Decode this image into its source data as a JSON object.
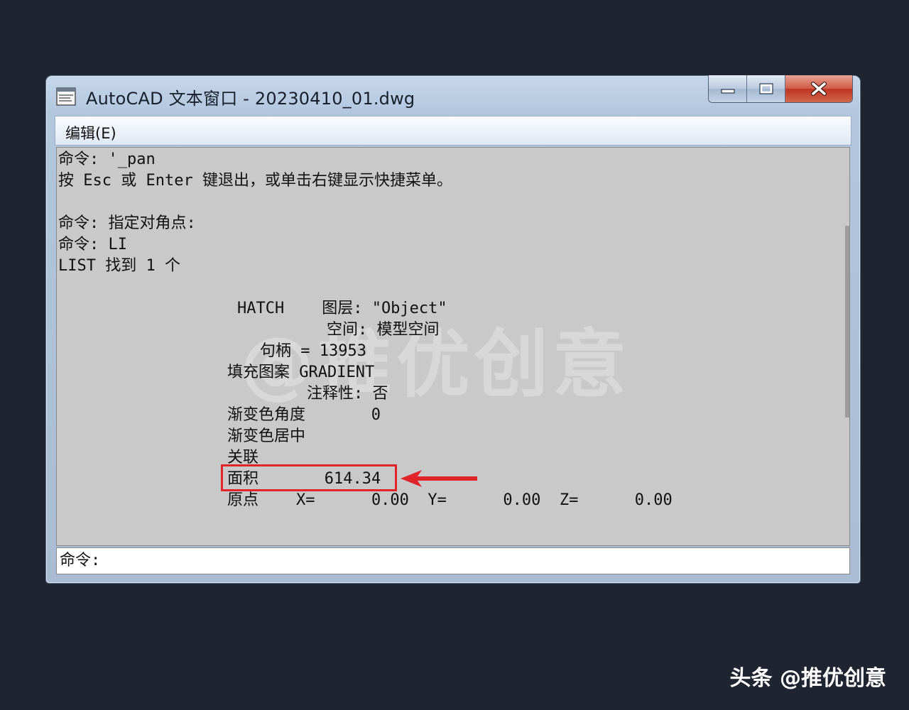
{
  "window": {
    "title": "AutoCAD 文本窗口 - 20230410_01.dwg",
    "controls": {
      "minimize_icon": "minimize-icon",
      "maximize_icon": "maximize-icon",
      "close_icon": "close-icon"
    }
  },
  "menu": {
    "edit_label": "编辑(E)"
  },
  "output_lines": [
    "命令: '_pan",
    "按 Esc 或 Enter 键退出，或单击右键显示快捷菜单。",
    "命令: 指定对角点:",
    "命令: LI",
    "LIST 找到 1 个",
    "HATCH    图层: \"Object\"",
    "空间: 模型空间",
    "句柄 = 13953",
    "填充图案 GRADIENT",
    "注释性: 否",
    "渐变色角度       0",
    "渐变色居中",
    "关联",
    "面积       614.34",
    "原点    X=      0.00  Y=      0.00  Z=      0.00"
  ],
  "command_prompt": "命令:",
  "annotation": {
    "highlight_color": "#e0242a",
    "highlighted_value": "614.34"
  },
  "watermark": "@推优创意",
  "footer_credit": "头条 @推优创意"
}
